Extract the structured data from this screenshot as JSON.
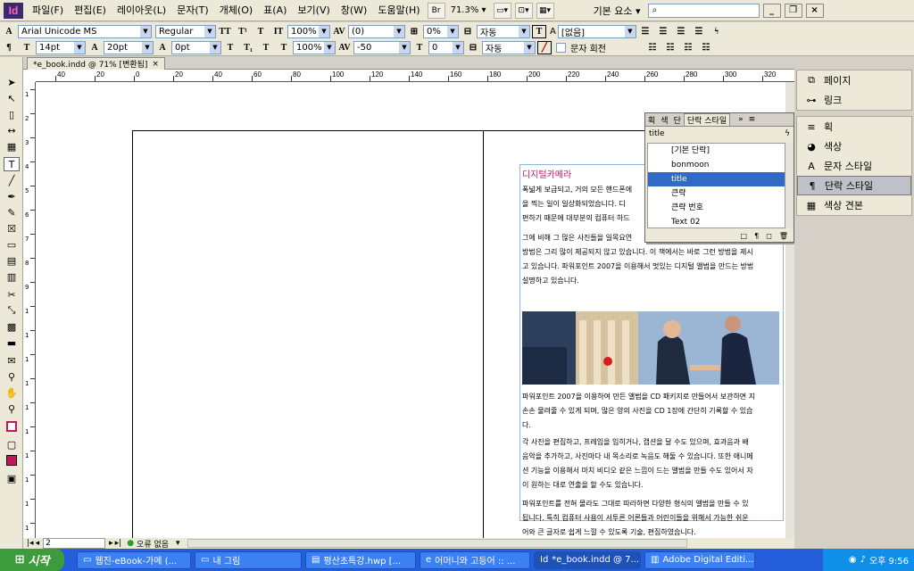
{
  "menubar": {
    "logo": "Id",
    "items": [
      "파일(F)",
      "편집(E)",
      "레이아웃(L)",
      "문자(T)",
      "개체(O)",
      "표(A)",
      "보기(V)",
      "창(W)",
      "도움말(H)"
    ],
    "br_label": "Br",
    "zoom": "71.3%",
    "workspace": "기본 요소",
    "workspace_arrow": "▾"
  },
  "control": {
    "font_family": "Arial Unicode MS",
    "font_style": "Regular",
    "font_size": "14pt",
    "leading": "20pt",
    "h_scale": "100%",
    "v_scale": "100%",
    "kerning": "(0)",
    "tracking": "-50",
    "skew": "0%",
    "baseline": "0pt",
    "baseline2": "0",
    "lang1": "자동",
    "lang2": "자동",
    "char_style": "[없음]",
    "rotate_label": "문자 회전",
    "tt_labels": [
      "TT",
      "T¹",
      "T"
    ],
    "tt_labels2": [
      "T",
      "T₁",
      "T"
    ]
  },
  "doc": {
    "tab_title": "*e_book.indd @ 71% [변환됨]",
    "close": "×",
    "ruler_labels": [
      "40",
      "20",
      "0",
      "20",
      "40",
      "60",
      "80",
      "100",
      "120",
      "140",
      "160",
      "180",
      "200",
      "220",
      "240",
      "260",
      "280",
      "300",
      "320"
    ],
    "vruler_labels": [
      "1",
      "2",
      "3",
      "4",
      "5",
      "6",
      "7",
      "8",
      "9",
      "1",
      "1",
      "1",
      "1",
      "1",
      "1",
      "1",
      "1",
      "1",
      "1"
    ],
    "heading": "디지털카메라",
    "paragraphs": [
      "폭넓게 보급되고, 거의 모든 핸드폰에\n을 찍는 일이 일상화되었습니다. 디\n편하기 때문에 대부분의 컴퓨터 하드",
      "그에 비해 그 많은 사진들을 일목요연\n방법은 그리 많이 제공되지 않고 있습니다. 이 책에서는 바로 그런 방법을 제시\n고 있습니다. 파워포인트 2007을 이용해서 멋있는 디지털 앨범을 만드는 방법\n설명하고 있습니다.",
      "파워포인트 2007을 이용하여 만든 앨범을 CD 패키지로 만들어서 보관하면 지\n손손 물려줄 수 있게 되며, 많은 양의 사진을 CD 1장에 간단히 기록할 수 있습\n다.",
      "각 사진을 편집하고, 프레임을 입히거나, 캡션을 달 수도 있으며, 효과음과 배\n음악을 추가하고, 사진마다 내 목소리로 녹음도 해둘 수 있습니다. 또한 애니메\n션 기능을 이용해서 마치 비디오 같은 느낌이 드는 앨범을 만들 수도 있어서 자\n이 원하는 대로 연출을 할 수도 있습니다.",
      "파워포인트를 전혀 몰라도 그대로 따라하면 다양한 형식의 앨범을 만들 수 있\n됩니다. 특히 컴퓨터 사용이 서투른 어른들과 어린이들을 위해서 가능한 쉬운\n어와 큰 글자로 쉽게 느낄 수 있도록 기술, 편집하였습니다."
    ],
    "page_number": "2",
    "error_status": "오류 없음"
  },
  "style_panel": {
    "tabs": [
      "획",
      "색",
      "단",
      "단락 스타일"
    ],
    "more": "»",
    "current": "title",
    "items": [
      "[기본 단락]",
      "bonmoon",
      "title",
      "큰략",
      "큰략 번호",
      "Text 02"
    ],
    "selected_index": 2,
    "foot_icons": [
      "□",
      "¶",
      "◻",
      "🗑"
    ]
  },
  "right_panel": {
    "group1": [
      {
        "label": "페이지",
        "icon": "pages-icon"
      },
      {
        "label": "링크",
        "icon": "links-icon"
      }
    ],
    "group2": [
      {
        "label": "획",
        "icon": "stroke-icon"
      },
      {
        "label": "색상",
        "icon": "color-icon"
      },
      {
        "label": "문자 스타일",
        "icon": "char-style-icon"
      },
      {
        "label": "단락 스타일",
        "icon": "para-style-icon"
      },
      {
        "label": "색상 견본",
        "icon": "swatches-icon"
      }
    ],
    "selected": "단락 스타일"
  },
  "taskbar": {
    "start": "시작",
    "tasks": [
      "웹진-eBook-가메 (...",
      "내 그림",
      "평산초특강.hwp [...",
      "어머니와 고등어 :: ...",
      "*e_book.indd @ 7...",
      "Adobe Digital Editi..."
    ],
    "active_index": 4,
    "clock": "오후 9:56"
  },
  "colors": {
    "accent_selection": "#316ac5",
    "heading_magenta": "#c2185b",
    "taskbar_blue": "#245edb",
    "start_green": "#3c9b3c"
  }
}
